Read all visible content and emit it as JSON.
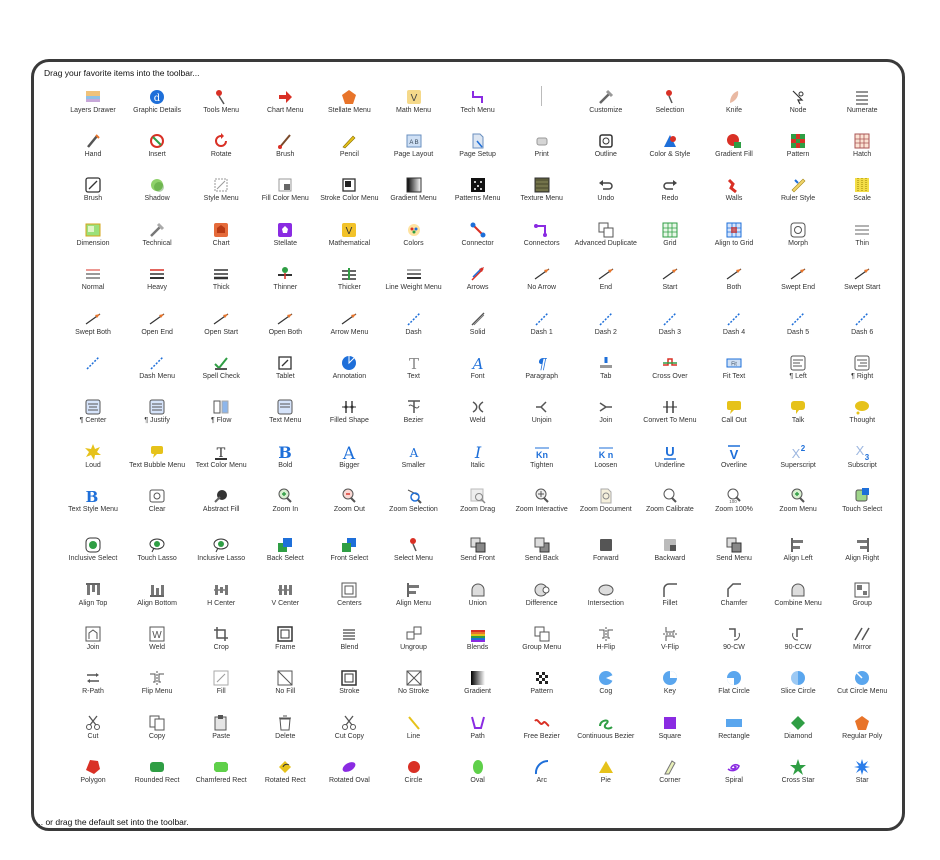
{
  "header": "Drag your favorite items into the toolbar...",
  "footer": "... or drag the default set into the toolbar.",
  "colors": {
    "accent": "#1e6fd9",
    "red": "#d93025",
    "green": "#2f9e44",
    "orange": "#e8742a",
    "yellow": "#e6c21a",
    "purple": "#8a2be2",
    "gray": "#5f5f5f"
  },
  "rows": [
    [
      {
        "label": "Layers Drawer",
        "icon": "layers-icon"
      },
      {
        "label": "Graphic Details",
        "icon": "info-icon"
      },
      {
        "label": "Tools Menu",
        "icon": "tools-icon"
      },
      {
        "label": "Chart Menu",
        "icon": "chart-icon"
      },
      {
        "label": "Stellate Menu",
        "icon": "stellate-icon"
      },
      {
        "label": "Math Menu",
        "icon": "math-icon"
      },
      {
        "label": "Tech Menu",
        "icon": "tech-icon"
      },
      {
        "label": "",
        "icon": "separator"
      },
      {
        "label": "Customize",
        "icon": "customize-icon"
      },
      {
        "label": "Selection",
        "icon": "pin-icon"
      },
      {
        "label": "Knife",
        "icon": "knife-icon"
      },
      {
        "label": "Node",
        "icon": "node-icon"
      },
      {
        "label": "Numerate",
        "icon": "numerate-icon"
      }
    ],
    [
      {
        "label": "Hand",
        "icon": "hand-icon"
      },
      {
        "label": "Insert",
        "icon": "insert-icon"
      },
      {
        "label": "Rotate",
        "icon": "rotate-icon"
      },
      {
        "label": "Brush",
        "icon": "brush-icon"
      },
      {
        "label": "Pencil",
        "icon": "pencil-icon"
      },
      {
        "label": "Page Layout",
        "icon": "page-layout-icon"
      },
      {
        "label": "Page Setup",
        "icon": "page-setup-icon"
      },
      {
        "label": "Print",
        "icon": "print-icon"
      },
      {
        "label": "Outline",
        "icon": "outline-icon"
      },
      {
        "label": "Color & Style",
        "icon": "color-style-icon"
      },
      {
        "label": "Gradient Fill",
        "icon": "gradient-fill-icon"
      },
      {
        "label": "Pattern",
        "icon": "pattern-icon"
      },
      {
        "label": "Hatch",
        "icon": "hatch-icon"
      }
    ],
    [
      {
        "label": "Brush",
        "icon": "brush-box-icon"
      },
      {
        "label": "Shadow",
        "icon": "shadow-icon"
      },
      {
        "label": "Style Menu",
        "icon": "style-menu-icon"
      },
      {
        "label": "Fill Color Menu",
        "icon": "fill-color-icon"
      },
      {
        "label": "Stroke Color Menu",
        "icon": "stroke-color-icon"
      },
      {
        "label": "Gradient Menu",
        "icon": "gradient-menu-icon"
      },
      {
        "label": "Patterns Menu",
        "icon": "patterns-menu-icon"
      },
      {
        "label": "Texture Menu",
        "icon": "texture-menu-icon"
      },
      {
        "label": "Undo",
        "icon": "undo-icon"
      },
      {
        "label": "Redo",
        "icon": "redo-icon"
      },
      {
        "label": "Walls",
        "icon": "walls-icon"
      },
      {
        "label": "Ruler Style",
        "icon": "ruler-icon"
      },
      {
        "label": "Scale",
        "icon": "scale-icon"
      }
    ],
    [
      {
        "label": "Dimension",
        "icon": "dimension-icon"
      },
      {
        "label": "Technical",
        "icon": "technical-icon"
      },
      {
        "label": "Chart",
        "icon": "chart-box-icon"
      },
      {
        "label": "Stellate",
        "icon": "stellate-box-icon"
      },
      {
        "label": "Mathematical",
        "icon": "mathematical-icon"
      },
      {
        "label": "Colors",
        "icon": "colors-icon"
      },
      {
        "label": "Connector",
        "icon": "connector-icon"
      },
      {
        "label": "Connectors",
        "icon": "connectors-icon"
      },
      {
        "label": "Advanced Duplicate",
        "icon": "duplicate-icon"
      },
      {
        "label": "Grid",
        "icon": "grid-icon"
      },
      {
        "label": "Align to Grid",
        "icon": "align-grid-icon"
      },
      {
        "label": "Morph",
        "icon": "morph-icon"
      },
      {
        "label": "Thin",
        "icon": "thin-icon"
      }
    ],
    [
      {
        "label": "Normal",
        "icon": "normal-line-icon"
      },
      {
        "label": "Heavy",
        "icon": "heavy-line-icon"
      },
      {
        "label": "Thick",
        "icon": "thick-line-icon"
      },
      {
        "label": "Thinner",
        "icon": "thinner-icon"
      },
      {
        "label": "Thicker",
        "icon": "thicker-icon"
      },
      {
        "label": "Line Weight Menu",
        "icon": "line-weight-icon"
      },
      {
        "label": "Arrows",
        "icon": "arrows-icon"
      },
      {
        "label": "No Arrow",
        "icon": "arrow-line-icon"
      },
      {
        "label": "End",
        "icon": "arrow-line-icon"
      },
      {
        "label": "Start",
        "icon": "arrow-line-icon"
      },
      {
        "label": "Both",
        "icon": "arrow-line-icon"
      },
      {
        "label": "Swept End",
        "icon": "arrow-line-icon"
      },
      {
        "label": "Swept Start",
        "icon": "arrow-line-icon"
      }
    ],
    [
      {
        "label": "Swept Both",
        "icon": "arrow-line-icon"
      },
      {
        "label": "Open End",
        "icon": "arrow-line-icon"
      },
      {
        "label": "Open Start",
        "icon": "arrow-line-icon"
      },
      {
        "label": "Open Both",
        "icon": "arrow-line-icon"
      },
      {
        "label": "Arrow Menu",
        "icon": "arrow-line-icon"
      },
      {
        "label": "Dash",
        "icon": "dash-icon"
      },
      {
        "label": "Solid",
        "icon": "solid-line-icon"
      },
      {
        "label": "Dash 1",
        "icon": "dash-icon"
      },
      {
        "label": "Dash 2",
        "icon": "dash-icon"
      },
      {
        "label": "Dash 3",
        "icon": "dash-icon"
      },
      {
        "label": "Dash 4",
        "icon": "dash-icon"
      },
      {
        "label": "Dash 5",
        "icon": "dash-icon"
      },
      {
        "label": "Dash 6",
        "icon": "dash-icon"
      }
    ],
    [
      {
        "label": "",
        "icon": "dash-icon"
      },
      {
        "label": "Dash Menu",
        "icon": "dash-icon"
      },
      {
        "label": "Spell Check",
        "icon": "spell-check-icon"
      },
      {
        "label": "Tablet",
        "icon": "tablet-icon"
      },
      {
        "label": "Annotation",
        "icon": "annotation-icon"
      },
      {
        "label": "Text",
        "icon": "text-icon"
      },
      {
        "label": "Font",
        "icon": "font-icon"
      },
      {
        "label": "Paragraph",
        "icon": "paragraph-icon"
      },
      {
        "label": "Tab",
        "icon": "tab-icon"
      },
      {
        "label": "Cross Over",
        "icon": "cross-over-icon"
      },
      {
        "label": "Fit Text",
        "icon": "fit-text-icon"
      },
      {
        "label": "¶ Left",
        "icon": "align-left-text-icon"
      },
      {
        "label": "¶ Right",
        "icon": "align-right-text-icon"
      }
    ],
    [
      {
        "label": "¶ Center",
        "icon": "align-center-text-icon"
      },
      {
        "label": "¶ Justify",
        "icon": "justify-text-icon"
      },
      {
        "label": "¶ Flow",
        "icon": "flow-text-icon"
      },
      {
        "label": "Text Menu",
        "icon": "text-menu-icon"
      },
      {
        "label": "Filled Shape",
        "icon": "filled-shape-icon"
      },
      {
        "label": "Bezier",
        "icon": "bezier-icon"
      },
      {
        "label": "Weld",
        "icon": "weld-icon"
      },
      {
        "label": "Unjoin",
        "icon": "unjoin-icon"
      },
      {
        "label": "Join",
        "icon": "join-icon"
      },
      {
        "label": "Convert To Menu",
        "icon": "convert-icon"
      },
      {
        "label": "Call Out",
        "icon": "callout-icon"
      },
      {
        "label": "Talk",
        "icon": "talk-icon"
      },
      {
        "label": "Thought",
        "icon": "thought-icon"
      }
    ],
    [
      {
        "label": "Loud",
        "icon": "loud-icon"
      },
      {
        "label": "Text Bubble Menu",
        "icon": "bubble-menu-icon"
      },
      {
        "label": "Text Color Menu",
        "icon": "text-color-icon"
      },
      {
        "label": "Bold",
        "icon": "bold-icon"
      },
      {
        "label": "Bigger",
        "icon": "bigger-icon"
      },
      {
        "label": "Smaller",
        "icon": "smaller-icon"
      },
      {
        "label": "Italic",
        "icon": "italic-icon"
      },
      {
        "label": "Tighten",
        "icon": "tighten-icon"
      },
      {
        "label": "Loosen",
        "icon": "loosen-icon"
      },
      {
        "label": "Underline",
        "icon": "underline-icon"
      },
      {
        "label": "Overline",
        "icon": "overline-icon"
      },
      {
        "label": "Superscript",
        "icon": "superscript-icon"
      },
      {
        "label": "Subscript",
        "icon": "subscript-icon"
      }
    ],
    [
      {
        "label": "Text Style Menu",
        "icon": "text-style-icon"
      },
      {
        "label": "Clear",
        "icon": "clear-icon"
      },
      {
        "label": "Abstract Fill",
        "icon": "abstract-fill-icon"
      },
      {
        "label": "Zoom In",
        "icon": "zoom-in-icon"
      },
      {
        "label": "Zoom Out",
        "icon": "zoom-out-icon"
      },
      {
        "label": "Zoom Selection",
        "icon": "zoom-selection-icon"
      },
      {
        "label": "Zoom Drag",
        "icon": "zoom-drag-icon"
      },
      {
        "label": "Zoom Interactive",
        "icon": "zoom-interactive-icon"
      },
      {
        "label": "Zoom Document",
        "icon": "zoom-document-icon"
      },
      {
        "label": "Zoom Calibrate",
        "icon": "zoom-calibrate-icon"
      },
      {
        "label": "Zoom 100%",
        "icon": "zoom-100-icon"
      },
      {
        "label": "Zoom Menu",
        "icon": "zoom-menu-icon"
      },
      {
        "label": "Touch Select",
        "icon": "touch-select-icon"
      }
    ],
    [
      {
        "label": "Inclusive Select",
        "icon": "inclusive-select-icon"
      },
      {
        "label": "Touch Lasso",
        "icon": "lasso-icon"
      },
      {
        "label": "Inclusive Lasso",
        "icon": "lasso-icon"
      },
      {
        "label": "Back Select",
        "icon": "back-select-icon"
      },
      {
        "label": "Front Select",
        "icon": "front-select-icon"
      },
      {
        "label": "Select Menu",
        "icon": "select-menu-icon"
      },
      {
        "label": "Send Front",
        "icon": "send-front-icon"
      },
      {
        "label": "Send Back",
        "icon": "send-back-icon"
      },
      {
        "label": "Forward",
        "icon": "forward-icon"
      },
      {
        "label": "Backward",
        "icon": "backward-icon"
      },
      {
        "label": "Send Menu",
        "icon": "send-menu-icon"
      },
      {
        "label": "Align Left",
        "icon": "align-left-icon"
      },
      {
        "label": "Align Right",
        "icon": "align-right-icon"
      }
    ],
    [
      {
        "label": "Align Top",
        "icon": "align-top-icon"
      },
      {
        "label": "Align Bottom",
        "icon": "align-bottom-icon"
      },
      {
        "label": "H Center",
        "icon": "h-center-icon"
      },
      {
        "label": "V Center",
        "icon": "v-center-icon"
      },
      {
        "label": "Centers",
        "icon": "centers-icon"
      },
      {
        "label": "Align Menu",
        "icon": "align-menu-icon"
      },
      {
        "label": "Union",
        "icon": "union-icon"
      },
      {
        "label": "Difference",
        "icon": "difference-icon"
      },
      {
        "label": "Intersection",
        "icon": "intersection-icon"
      },
      {
        "label": "Fillet",
        "icon": "fillet-icon"
      },
      {
        "label": "Chamfer",
        "icon": "chamfer-icon"
      },
      {
        "label": "Combine Menu",
        "icon": "combine-icon"
      },
      {
        "label": "Group",
        "icon": "group-icon"
      }
    ],
    [
      {
        "label": "Join",
        "icon": "join-box-icon"
      },
      {
        "label": "Weld",
        "icon": "weld-box-icon"
      },
      {
        "label": "Crop",
        "icon": "crop-icon"
      },
      {
        "label": "Frame",
        "icon": "frame-icon"
      },
      {
        "label": "Blend",
        "icon": "blend-icon"
      },
      {
        "label": "Ungroup",
        "icon": "ungroup-icon"
      },
      {
        "label": "Blends",
        "icon": "blends-icon"
      },
      {
        "label": "Group Menu",
        "icon": "group-menu-icon"
      },
      {
        "label": "H-Flip",
        "icon": "h-flip-icon"
      },
      {
        "label": "V-Flip",
        "icon": "v-flip-icon"
      },
      {
        "label": "90-CW",
        "icon": "rotate-cw-icon"
      },
      {
        "label": "90-CCW",
        "icon": "rotate-ccw-icon"
      },
      {
        "label": "Mirror",
        "icon": "mirror-icon"
      }
    ],
    [
      {
        "label": "R-Path",
        "icon": "r-path-icon"
      },
      {
        "label": "Flip Menu",
        "icon": "flip-menu-icon"
      },
      {
        "label": "Fill",
        "icon": "fill-icon"
      },
      {
        "label": "No Fill",
        "icon": "no-fill-icon"
      },
      {
        "label": "Stroke",
        "icon": "stroke-icon"
      },
      {
        "label": "No Stroke",
        "icon": "no-stroke-icon"
      },
      {
        "label": "Gradient",
        "icon": "gradient-icon"
      },
      {
        "label": "Pattern",
        "icon": "pattern-small-icon"
      },
      {
        "label": "Cog",
        "icon": "cog-icon"
      },
      {
        "label": "Key",
        "icon": "key-icon"
      },
      {
        "label": "Flat Circle",
        "icon": "flat-circle-icon"
      },
      {
        "label": "Slice Circle",
        "icon": "slice-circle-icon"
      },
      {
        "label": "Cut Circle Menu",
        "icon": "cut-circle-icon"
      }
    ],
    [
      {
        "label": "Cut",
        "icon": "scissors-icon"
      },
      {
        "label": "Copy",
        "icon": "copy-icon"
      },
      {
        "label": "Paste",
        "icon": "paste-icon"
      },
      {
        "label": "Delete",
        "icon": "trash-icon"
      },
      {
        "label": "Cut Copy",
        "icon": "scissors-icon"
      },
      {
        "label": "Line",
        "icon": "line-icon"
      },
      {
        "label": "Path",
        "icon": "path-icon"
      },
      {
        "label": "Free Bezier",
        "icon": "free-bezier-icon"
      },
      {
        "label": "Continuous Bezier",
        "icon": "continuous-bezier-icon"
      },
      {
        "label": "Square",
        "icon": "square-icon"
      },
      {
        "label": "Rectangle",
        "icon": "rectangle-icon"
      },
      {
        "label": "Diamond",
        "icon": "diamond-icon"
      },
      {
        "label": "Regular Poly",
        "icon": "regular-poly-icon"
      }
    ],
    [
      {
        "label": "Polygon",
        "icon": "polygon-icon"
      },
      {
        "label": "Rounded Rect",
        "icon": "rounded-rect-icon"
      },
      {
        "label": "Chamfered Rect",
        "icon": "chamfered-rect-icon"
      },
      {
        "label": "Rotated Rect",
        "icon": "rotated-rect-icon"
      },
      {
        "label": "Rotated Oval",
        "icon": "rotated-oval-icon"
      },
      {
        "label": "Circle",
        "icon": "circle-icon"
      },
      {
        "label": "Oval",
        "icon": "oval-icon"
      },
      {
        "label": "Arc",
        "icon": "arc-icon"
      },
      {
        "label": "Pie",
        "icon": "pie-icon"
      },
      {
        "label": "Corner",
        "icon": "corner-icon"
      },
      {
        "label": "Spiral",
        "icon": "spiral-icon"
      },
      {
        "label": "Cross Star",
        "icon": "cross-star-icon"
      },
      {
        "label": "Star",
        "icon": "star-icon"
      }
    ]
  ]
}
